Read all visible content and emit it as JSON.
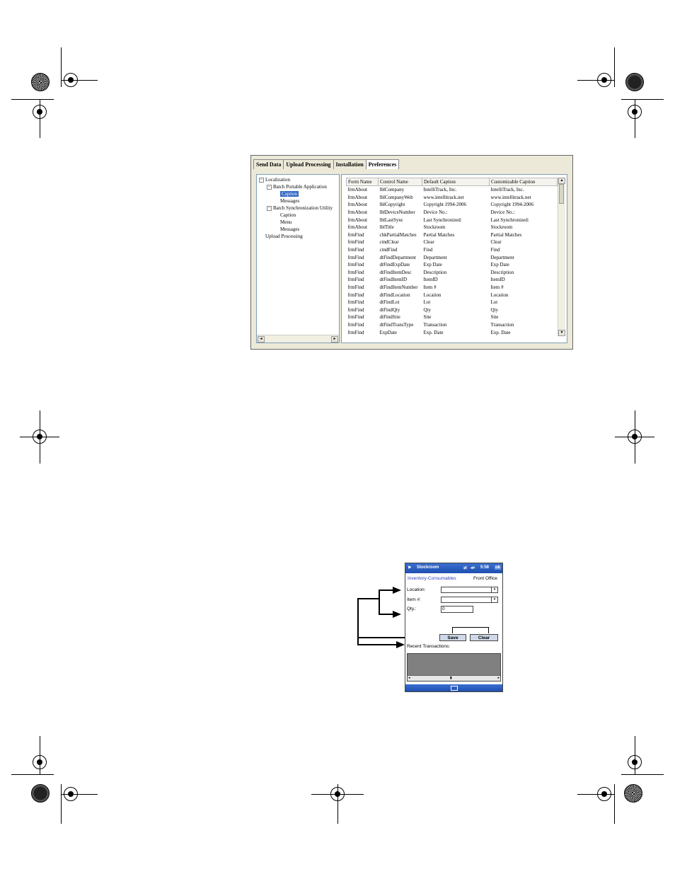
{
  "preferences_window": {
    "tabs": [
      {
        "label": "Send Data"
      },
      {
        "label": "Upload Processing"
      },
      {
        "label": "Installation"
      },
      {
        "label": "Preferences"
      }
    ],
    "tree": {
      "root": "Localization",
      "batch_portable": "Batch Portable Application",
      "bp_caption": "Caption",
      "bp_messages": "Messages",
      "batch_sync": "Batch Synchronization Utility",
      "bs_caption": "Caption",
      "bs_menu": "Menu",
      "bs_messages": "Messages",
      "upload_processing": "Upload Processing"
    },
    "grid": {
      "headers": [
        "Form Name",
        "Control Name",
        "Default Caption",
        "Customizable Caption"
      ],
      "rows": [
        [
          "frmAbout",
          "lblCompany",
          "IntelliTrack, Inc.",
          "IntelliTrack, Inc."
        ],
        [
          "frmAbout",
          "lblCompanyWeb",
          "www.intellitrack.net",
          "www.intellitrack.net"
        ],
        [
          "frmAbout",
          "lblCopyright",
          "Copyright 1994-2006",
          "Copyright 1994-2006"
        ],
        [
          "frmAbout",
          "lblDeviceNumber",
          "Device No.:",
          "Device No.:"
        ],
        [
          "frmAbout",
          "lblLastSync",
          "Last Synchronized:",
          "Last Synchronized:"
        ],
        [
          "frmAbout",
          "lblTitle",
          "Stockroom",
          "Stockroom"
        ],
        [
          "frmFind",
          "chkPartialMatches",
          "Partial Matches",
          "Partial Matches"
        ],
        [
          "frmFind",
          "cmdClear",
          "Clear",
          "Clear"
        ],
        [
          "frmFind",
          "cmdFind",
          "Find",
          "Find"
        ],
        [
          "frmFind",
          "dtFindDepartment",
          "Department",
          "Department"
        ],
        [
          "frmFind",
          "dtFindExpDate",
          "Exp Date",
          "Exp Date"
        ],
        [
          "frmFind",
          "dtFindItemDesc",
          "Description",
          "Description"
        ],
        [
          "frmFind",
          "dtFindItemID",
          "ItemID",
          "ItemID"
        ],
        [
          "frmFind",
          "dtFindItemNumber",
          "Item #",
          "Item #"
        ],
        [
          "frmFind",
          "dtFindLocation",
          "Location",
          "Location"
        ],
        [
          "frmFind",
          "dtFindLot",
          "Lot",
          "Lot"
        ],
        [
          "frmFind",
          "dtFindQty",
          "Qty",
          "Qty"
        ],
        [
          "frmFind",
          "dtFindSite",
          "Site",
          "Site"
        ],
        [
          "frmFind",
          "dtFindTransType",
          "Transaction",
          "Transaction"
        ],
        [
          "frmFind",
          "ExpDate",
          "Exp. Date",
          "Exp. Date"
        ]
      ]
    }
  },
  "ppc": {
    "title": "Stockroom",
    "time": "5:58",
    "ok": "ok",
    "context": "Inventory-Consumables",
    "site": "Front Office",
    "location_label": "Location:",
    "item_label": "Item #:",
    "qty_label": "Qty.:",
    "qty_value": "0",
    "save_label": "Save",
    "clear_label": "Clear",
    "recent_label": "Recent Transactions:"
  },
  "colors": {
    "selection": "#316ac5",
    "ppc_titlebar": "#1e4fb0",
    "ppc_context": "#2a3fb8"
  }
}
